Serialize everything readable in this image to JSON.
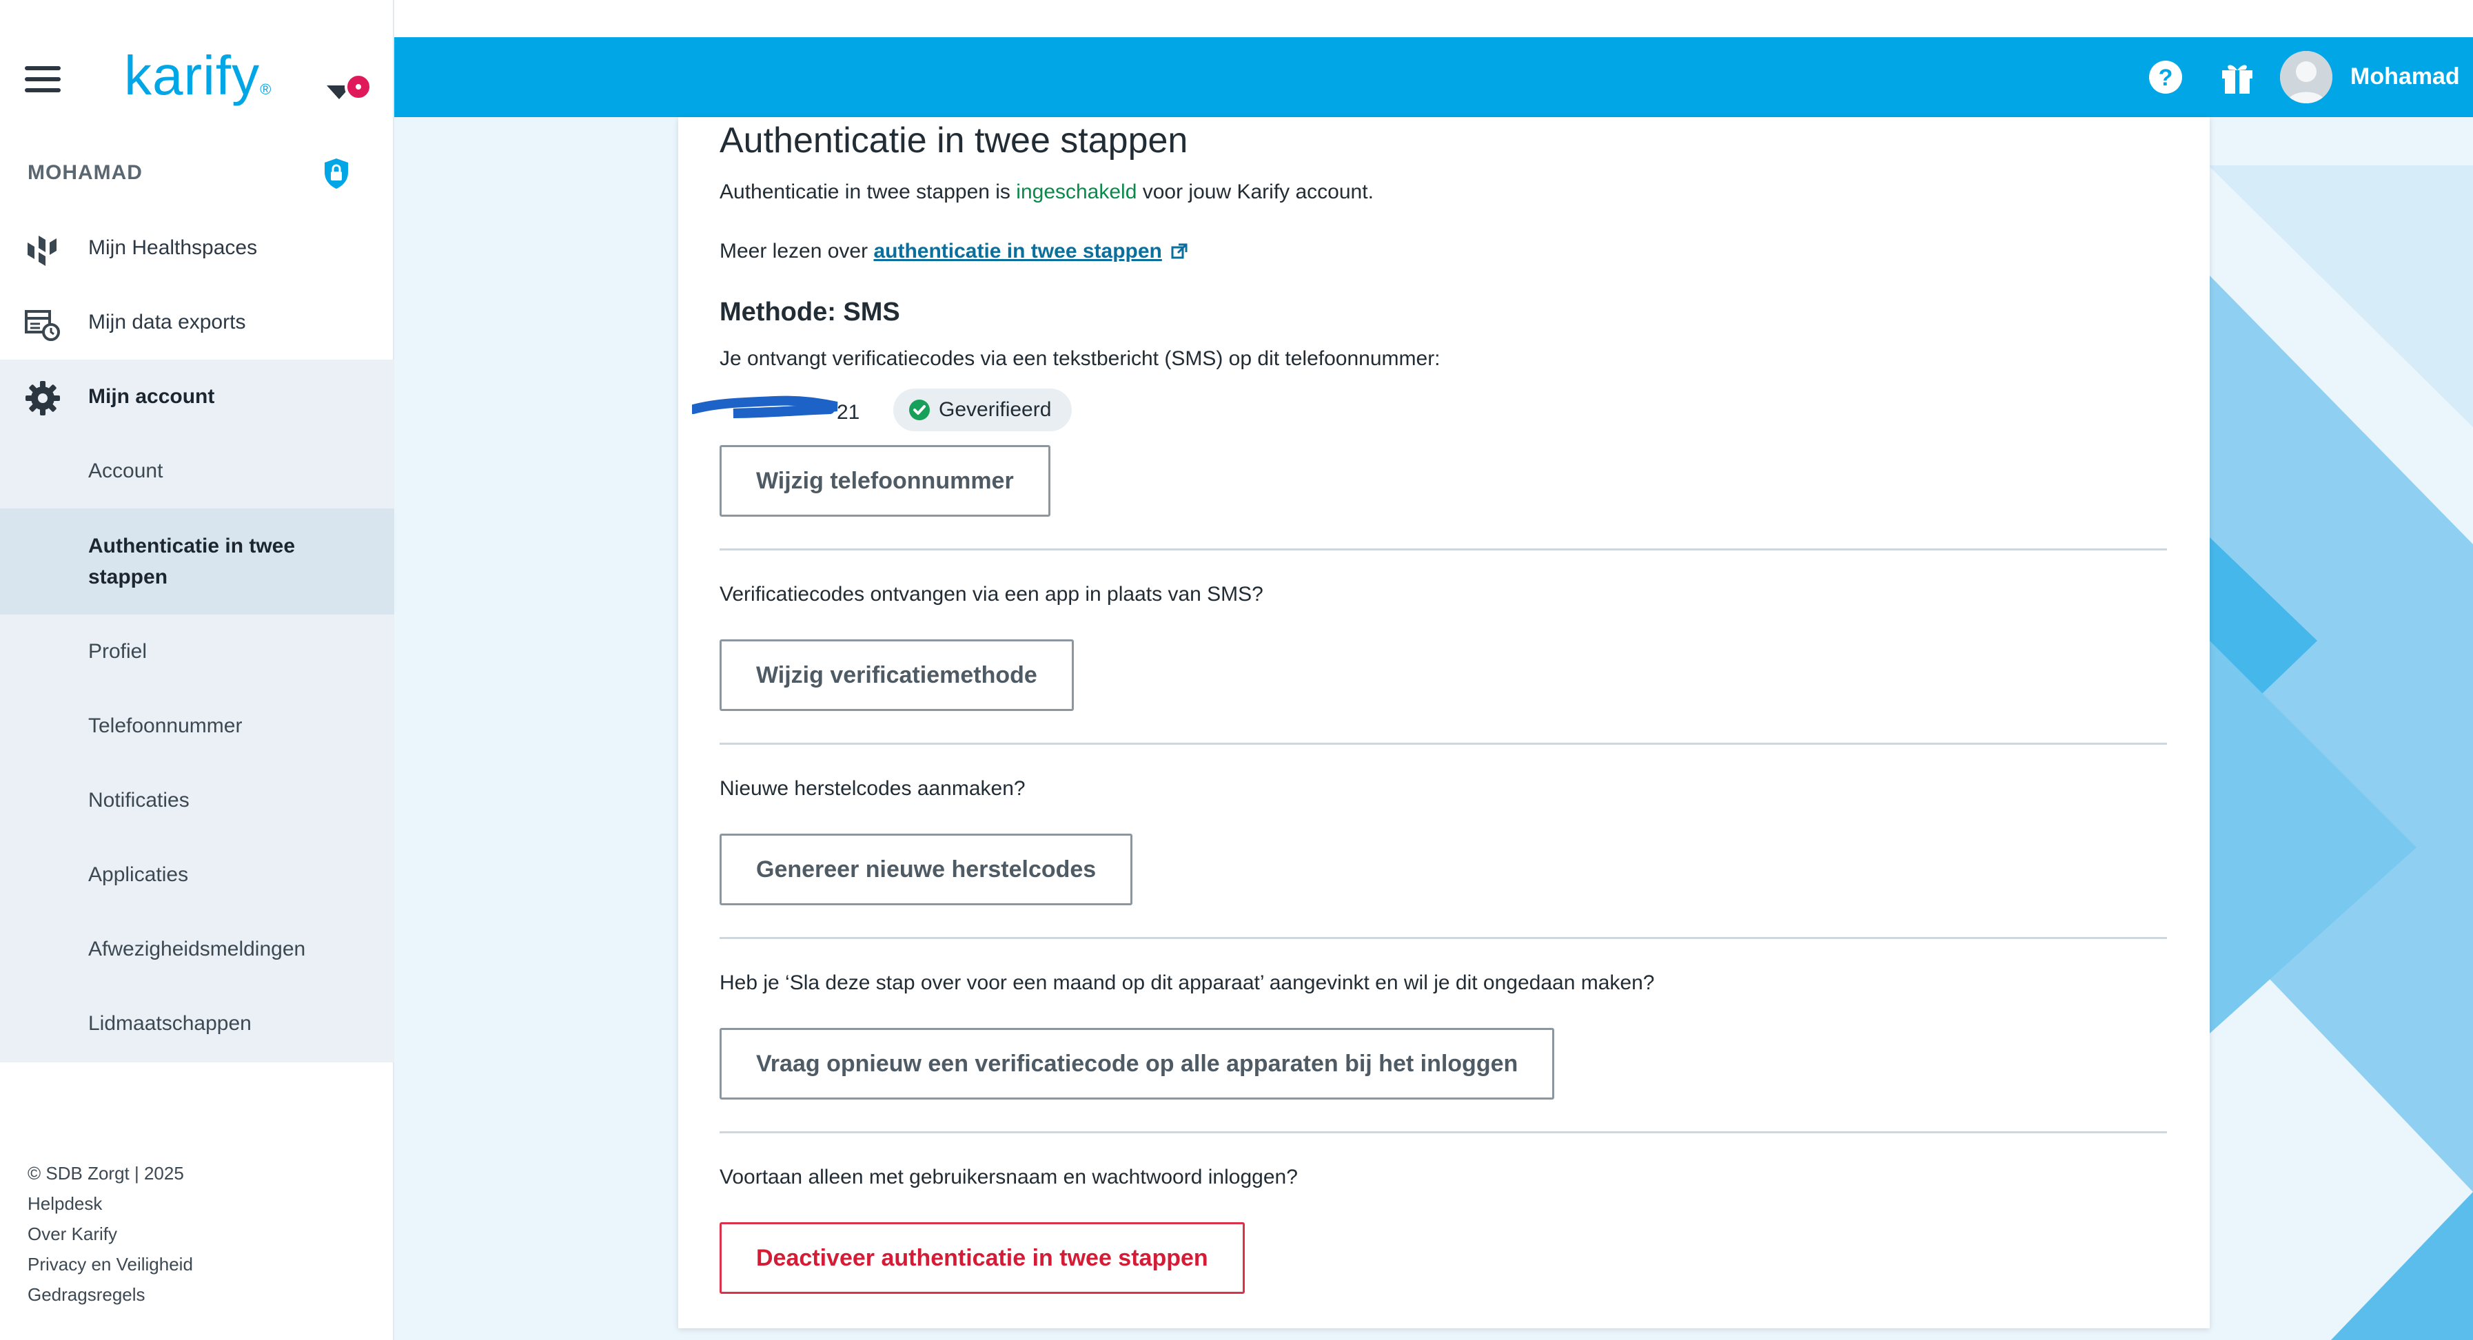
{
  "colors": {
    "brand": "#00a6e6",
    "enabled_text": "#0a8a4a",
    "danger": "#d41c36",
    "notification_dot": "#e0195a"
  },
  "sidebar": {
    "logo": "karify",
    "logo_mark": "®",
    "user": "MOHAMAD",
    "nav": [
      {
        "label": "Mijn Healthspaces",
        "icon": "healthspaces-icon"
      },
      {
        "label": "Mijn data exports",
        "icon": "data-export-icon"
      },
      {
        "label": "Mijn account",
        "icon": "gear-icon",
        "expanded": true
      }
    ],
    "sub_nav": [
      {
        "label": "Account"
      },
      {
        "label": "Authenticatie in twee stappen",
        "active": true
      },
      {
        "label": "Profiel"
      },
      {
        "label": "Telefoonnummer"
      },
      {
        "label": "Notificaties"
      },
      {
        "label": "Applicaties"
      },
      {
        "label": "Afwezigheidsmeldingen"
      },
      {
        "label": "Lidmaatschappen"
      }
    ],
    "footer": {
      "copyright": "© SDB Zorgt | 2025",
      "links": [
        "Helpdesk",
        "Over Karify",
        "Privacy en Veiligheid",
        "Gedragsregels"
      ]
    }
  },
  "topbar": {
    "user": "Mohamad",
    "icons": [
      "help-icon",
      "gift-icon",
      "avatar"
    ]
  },
  "card": {
    "title": "Authenticatie in twee stappen",
    "status_prefix": "Authenticatie in twee stappen is ",
    "status_value": "ingeschakeld",
    "status_suffix": " voor jouw Karify account.",
    "read_more_prefix": "Meer lezen over ",
    "read_more_link": "authenticatie in twee stappen",
    "method_title": "Methode: SMS",
    "method_description": "Je ontvangt verificatiecodes via een tekstbericht (SMS) op dit telefoonnummer:",
    "phone_suffix": "21",
    "verified_badge": "Geverifieerd",
    "sections": [
      {
        "button": "Wijzig telefoonnummer"
      },
      {
        "question": "Verificatiecodes ontvangen via een app in plaats van SMS?",
        "button": "Wijzig verificatiemethode"
      },
      {
        "question": "Nieuwe herstelcodes aanmaken?",
        "button": "Genereer nieuwe herstelcodes"
      },
      {
        "question": "Heb je ‘Sla deze stap over voor een maand op dit apparaat’ aangevinkt en wil je dit ongedaan maken?",
        "button": "Vraag opnieuw een verificatiecode op alle apparaten bij het inloggen"
      },
      {
        "question": "Voortaan alleen met gebruikersnaam en wachtwoord inloggen?",
        "button": "Deactiveer authenticatie in twee stappen",
        "danger": true
      }
    ]
  }
}
